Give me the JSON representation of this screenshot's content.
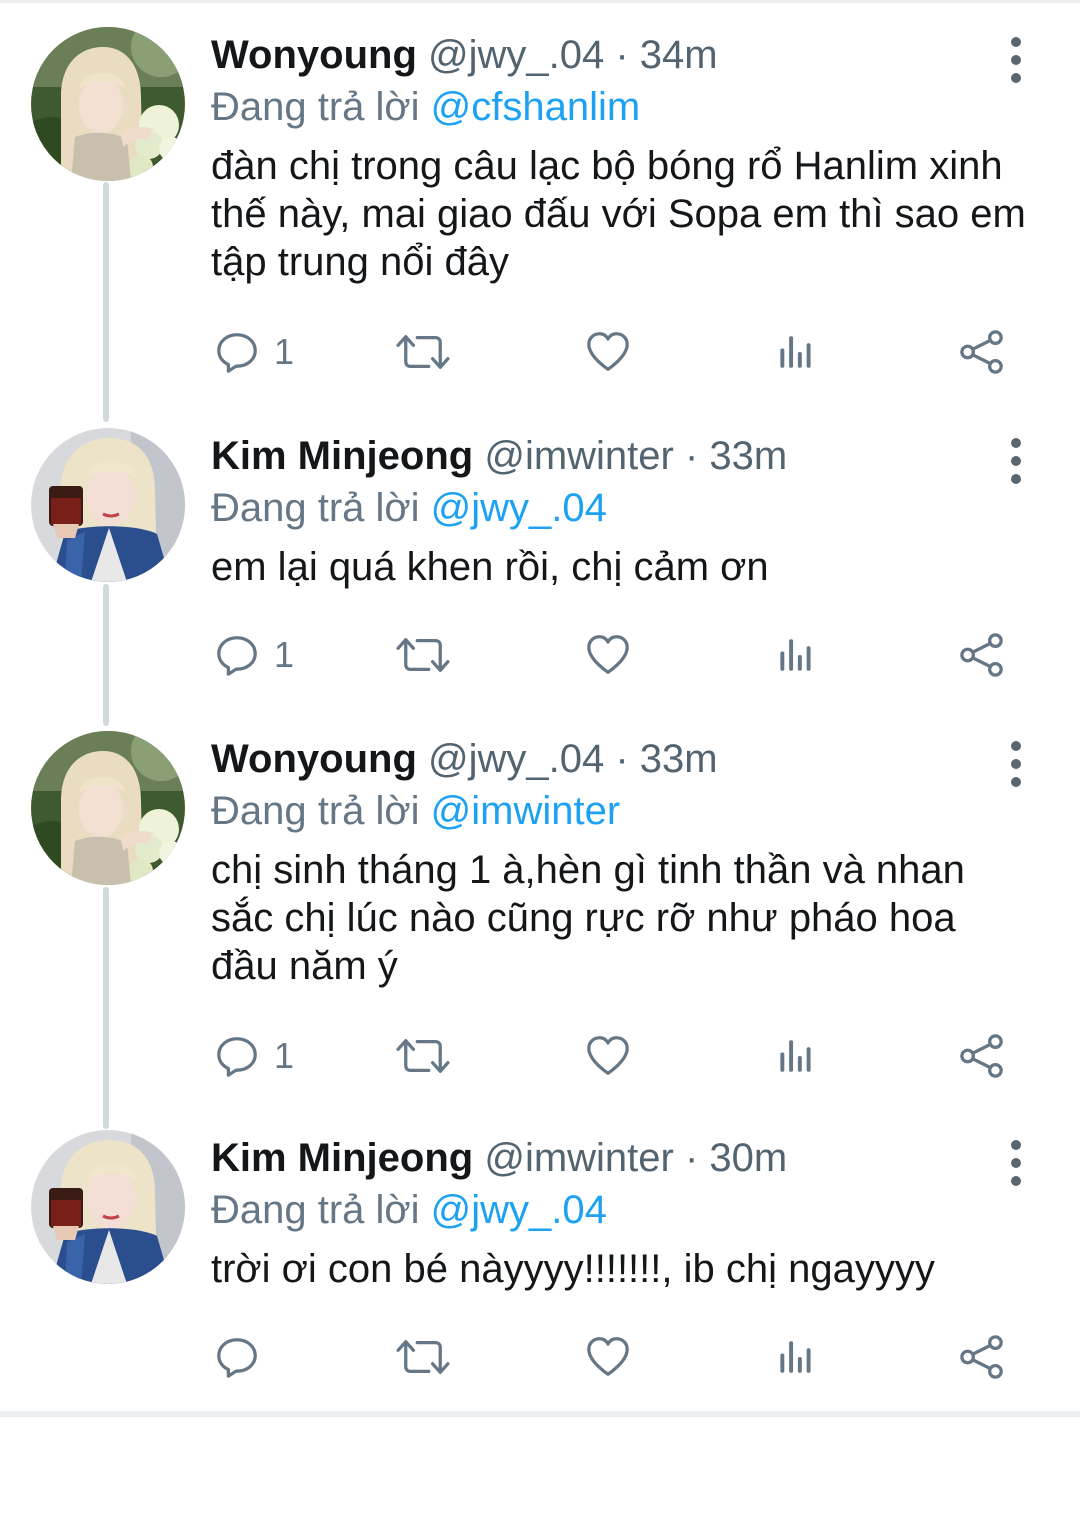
{
  "reply_prefix": "Đang trả lời ",
  "colors": {
    "link": "#1da1f2",
    "icon": "#657786",
    "name": "#14171a",
    "thread_line": "#cfd9de"
  },
  "icons": {
    "reply": "speech-bubble-icon",
    "retweet": "retweet-icon",
    "like": "heart-icon",
    "analytics": "bar-chart-icon",
    "share": "share-icon",
    "more": "vertical-ellipsis-icon"
  },
  "tweets": [
    {
      "name": "Wonyoung",
      "handle": "@jwy_.04",
      "time": "· 34m",
      "reply_to": "@cfshanlim",
      "text": "đàn chị trong câu lạc bộ bóng rổ Hanlim xinh thế này, mai giao đấu với Sopa em thì sao em tập trung nổi đây",
      "reply_count": "1",
      "avatar": "wonyoung-avatar"
    },
    {
      "name": "Kim Minjeong",
      "handle": "@imwinter",
      "time": "· 33m",
      "reply_to": "@jwy_.04",
      "text": "em lại quá khen rồi, chị cảm ơn",
      "reply_count": "1",
      "avatar": "minjeong-avatar"
    },
    {
      "name": "Wonyoung",
      "handle": "@jwy_.04",
      "time": "· 33m",
      "reply_to": "@imwinter",
      "text": "chị sinh tháng 1 à,hèn gì tinh thần và nhan sắc chị lúc nào cũng rực rỡ như pháo hoa đầu năm ý",
      "reply_count": "1",
      "avatar": "wonyoung-avatar"
    },
    {
      "name": "Kim Minjeong",
      "handle": "@imwinter",
      "time": "· 30m",
      "reply_to": "@jwy_.04",
      "text": "trời ơi con bé nàyyyy!!!!!!!, ib chị ngayyyy",
      "reply_count": "",
      "avatar": "minjeong-avatar"
    }
  ]
}
